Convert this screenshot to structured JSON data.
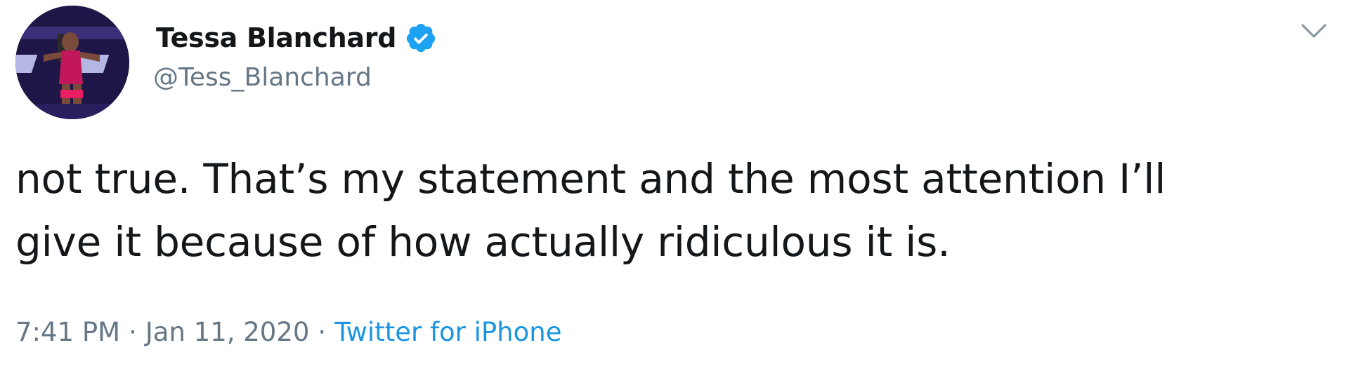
{
  "author": {
    "name": "Tessa Blanchard",
    "handle": "@Tess_Blanchard",
    "verified_icon": "verified-badge-icon",
    "avatar_icon": "profile-avatar"
  },
  "tweet": {
    "text_lines": [
      "not true. That’s my statement and the most attention I’ll",
      "give it because of how actually ridiculous it is."
    ],
    "time": "7:41 PM",
    "separator": "·",
    "date": "Jan 11, 2020",
    "source": "Twitter for iPhone"
  },
  "menu": {
    "icon": "chevron-down-icon"
  },
  "colors": {
    "text": "#14171a",
    "muted": "#657786",
    "link": "#1b95e0",
    "verified": "#1da1f2"
  }
}
